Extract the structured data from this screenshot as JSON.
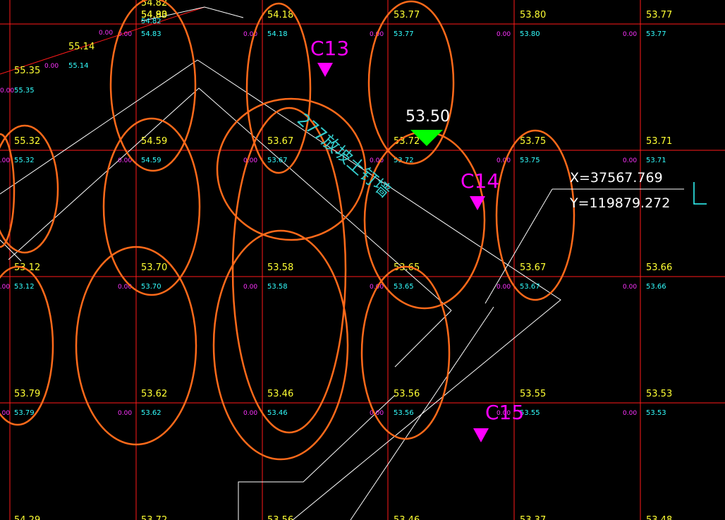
{
  "colors": {
    "background": "#000000",
    "grid": "#ff1a1a",
    "elevation_text": "#ffff33",
    "subtext": "#33ffff",
    "zero_text": "#ff33ff",
    "outline": "#ff6a1a",
    "marker": "#ff00ff",
    "point_marker": "#00ff00",
    "boundary": "#ffffff",
    "wall_label": "#33cccc",
    "coord_text": "#ffffff"
  },
  "grid": {
    "rows": [
      {
        "cells": [
          "",
          "54.90",
          "54.18",
          "53.77",
          "53.80",
          "53.77"
        ],
        "sub": [
          "",
          "54.83",
          "54.18",
          "53.77",
          "53.80",
          "53.77"
        ]
      },
      {
        "cells": [
          "55.32",
          "54.59",
          "53.67",
          "53.72",
          "53.75",
          "53.71"
        ],
        "sub": [
          "55.32",
          "54.59",
          "53.67",
          "53.72",
          "53.75",
          "53.71"
        ]
      },
      {
        "cells": [
          "53.12",
          "53.70",
          "53.58",
          "53.65",
          "53.67",
          "53.66"
        ],
        "sub": [
          "53.12",
          "53.70",
          "53.58",
          "53.65",
          "53.67",
          "53.66"
        ]
      },
      {
        "cells": [
          "53.79",
          "53.62",
          "53.46",
          "53.56",
          "53.55",
          "53.53"
        ],
        "sub": [
          "53.79",
          "53.62",
          "53.46",
          "53.56",
          "53.55",
          "53.53"
        ]
      },
      {
        "cells": [
          "54.29",
          "53.72",
          "53.56",
          "53.46",
          "53.37",
          "53.48"
        ],
        "sub": [
          "",
          "",
          "",
          "",
          "",
          ""
        ]
      }
    ],
    "zero_label": "0.00",
    "extra_labels": [
      {
        "text": "54.82",
        "kind": "elev"
      },
      {
        "text": "54.83",
        "kind": "elev"
      },
      {
        "text": "54.82",
        "kind": "sub"
      },
      {
        "text": "55.14",
        "kind": "elev"
      },
      {
        "text": "55.14",
        "kind": "sub"
      },
      {
        "text": "55.35",
        "kind": "elev"
      },
      {
        "text": "55.35",
        "kind": "sub"
      }
    ]
  },
  "markers": [
    {
      "label": "C13"
    },
    {
      "label": "C14"
    },
    {
      "label": "C15"
    }
  ],
  "point": {
    "elevation": "53.50"
  },
  "coords": {
    "x": "X=37567.769",
    "y": "Y=119879.272"
  },
  "wall_label": "277放坡土钉墙"
}
